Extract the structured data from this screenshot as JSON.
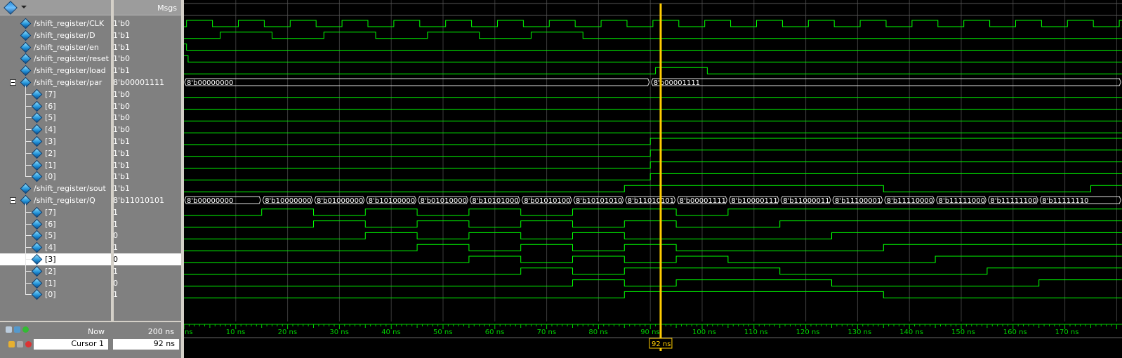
{
  "header": {
    "msgs_label": "Msgs"
  },
  "signals": [
    {
      "name": "/shift_register/CLK",
      "value": "1'b0"
    },
    {
      "name": "/shift_register/D",
      "value": "1'b1"
    },
    {
      "name": "/shift_register/en",
      "value": "1'b1"
    },
    {
      "name": "/shift_register/reset",
      "value": "1'b0"
    },
    {
      "name": "/shift_register/load",
      "value": "1'b1"
    },
    {
      "name": "/shift_register/par",
      "value": "8'b00001111"
    },
    {
      "name": "[7]",
      "value": "1'b0"
    },
    {
      "name": "[6]",
      "value": "1'b0"
    },
    {
      "name": "[5]",
      "value": "1'b0"
    },
    {
      "name": "[4]",
      "value": "1'b0"
    },
    {
      "name": "[3]",
      "value": "1'b1"
    },
    {
      "name": "[2]",
      "value": "1'b1"
    },
    {
      "name": "[1]",
      "value": "1'b1"
    },
    {
      "name": "[0]",
      "value": "1'b1"
    },
    {
      "name": "/shift_register/sout",
      "value": "1'b1"
    },
    {
      "name": "/shift_register/Q",
      "value": "8'b11010101"
    },
    {
      "name": "[7]",
      "value": "1"
    },
    {
      "name": "[6]",
      "value": "1"
    },
    {
      "name": "[5]",
      "value": "0"
    },
    {
      "name": "[4]",
      "value": "1"
    },
    {
      "name": "[3]",
      "value": "0"
    },
    {
      "name": "[2]",
      "value": "1"
    },
    {
      "name": "[1]",
      "value": "0"
    },
    {
      "name": "[0]",
      "value": "1"
    }
  ],
  "bus_labels": {
    "par": [
      "8'b00000000",
      "8'b00001111"
    ],
    "Q": [
      "8'b00000000",
      "8'b10000000",
      "8'b01000000",
      "8'b10100000",
      "8'b01010000",
      "8'b10101000",
      "8'b01010100",
      "8'b10101010",
      "8'b11010101",
      "8'b00001111",
      "8'b10000111",
      "8'b11000011",
      "8'b11100001",
      "8'b11110000",
      "8'b11111000",
      "8'b11111100",
      "8'b11111110"
    ]
  },
  "timeline": {
    "ticks": [
      "10 ns",
      "20 ns",
      "30 ns",
      "40 ns",
      "50 ns",
      "60 ns",
      "70 ns",
      "80 ns",
      "90 ns",
      "100 ns",
      "110 ns",
      "120 ns",
      "130 ns",
      "140 ns",
      "150 ns",
      "160 ns",
      "170 ns"
    ],
    "left_fragment": "ns",
    "now_label": "Now",
    "now_value": "200 ns",
    "cursor_label": "Cursor 1",
    "cursor_value": "92 ns",
    "cursor_flag": "92 ns"
  },
  "colors": {
    "wave": "#00ff00",
    "cursor": "#ffcc00",
    "grid": "#3a3a3a"
  }
}
